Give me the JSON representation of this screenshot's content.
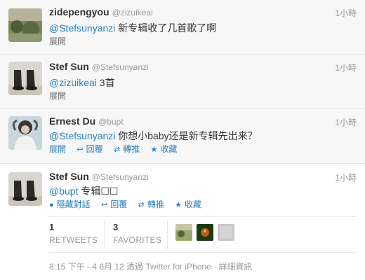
{
  "tweets": [
    {
      "fullname": "zidepengyou",
      "screenname": "@zizuikeai",
      "time": "1小時",
      "mention": "@Stefsunyanzi",
      "text": "新专辑收了几首歌了啊",
      "expand": "展開"
    },
    {
      "fullname": "Stef Sun",
      "screenname": "@Stefsunyanzi",
      "time": "1小時",
      "mention": "@zizuikeai",
      "text": "3首",
      "expand": "展開"
    },
    {
      "fullname": "Ernest Du",
      "screenname": "@bupt",
      "time": "1小時",
      "mention": "@Stefsunyanzi",
      "text": "你想小baby还是新专辑先出来？",
      "expand": "展開",
      "reply": "回覆",
      "retweet": "轉推",
      "favorite": "收藏"
    },
    {
      "fullname": "Stef Sun",
      "screenname": "@Stefsunyanzi",
      "time": "1小時",
      "mention": "@bupt",
      "text": "专辑☐☐",
      "hide_conversation": "隱藏對話",
      "reply": "回覆",
      "retweet": "轉推",
      "favorite": "收藏"
    }
  ],
  "stats": {
    "retweets_count": "1",
    "retweets_label": "RETWEETS",
    "favorites_count": "3",
    "favorites_label": "FAVORITES"
  },
  "footer": "8:15 下午 - 4 6月 12 透過 Twitter for iPhone · 詳細資訊",
  "icons": {
    "reply": "reply-icon",
    "retweet": "retweet-icon",
    "favorite": "star-icon",
    "conversation": "speech-bubble-icon"
  },
  "colors": {
    "link": "#2a7fbf",
    "muted": "#999999",
    "text": "#333333"
  }
}
